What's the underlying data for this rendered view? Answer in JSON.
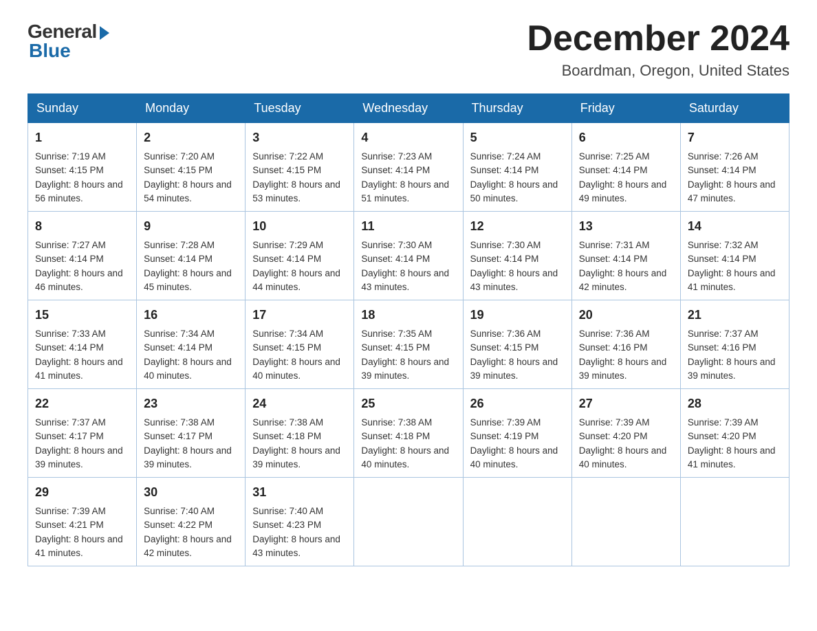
{
  "header": {
    "logo_general": "General",
    "logo_blue": "Blue",
    "month_year": "December 2024",
    "location": "Boardman, Oregon, United States"
  },
  "days_of_week": [
    "Sunday",
    "Monday",
    "Tuesday",
    "Wednesday",
    "Thursday",
    "Friday",
    "Saturday"
  ],
  "weeks": [
    [
      {
        "day": "1",
        "sunrise": "7:19 AM",
        "sunset": "4:15 PM",
        "daylight": "8 hours and 56 minutes."
      },
      {
        "day": "2",
        "sunrise": "7:20 AM",
        "sunset": "4:15 PM",
        "daylight": "8 hours and 54 minutes."
      },
      {
        "day": "3",
        "sunrise": "7:22 AM",
        "sunset": "4:15 PM",
        "daylight": "8 hours and 53 minutes."
      },
      {
        "day": "4",
        "sunrise": "7:23 AM",
        "sunset": "4:14 PM",
        "daylight": "8 hours and 51 minutes."
      },
      {
        "day": "5",
        "sunrise": "7:24 AM",
        "sunset": "4:14 PM",
        "daylight": "8 hours and 50 minutes."
      },
      {
        "day": "6",
        "sunrise": "7:25 AM",
        "sunset": "4:14 PM",
        "daylight": "8 hours and 49 minutes."
      },
      {
        "day": "7",
        "sunrise": "7:26 AM",
        "sunset": "4:14 PM",
        "daylight": "8 hours and 47 minutes."
      }
    ],
    [
      {
        "day": "8",
        "sunrise": "7:27 AM",
        "sunset": "4:14 PM",
        "daylight": "8 hours and 46 minutes."
      },
      {
        "day": "9",
        "sunrise": "7:28 AM",
        "sunset": "4:14 PM",
        "daylight": "8 hours and 45 minutes."
      },
      {
        "day": "10",
        "sunrise": "7:29 AM",
        "sunset": "4:14 PM",
        "daylight": "8 hours and 44 minutes."
      },
      {
        "day": "11",
        "sunrise": "7:30 AM",
        "sunset": "4:14 PM",
        "daylight": "8 hours and 43 minutes."
      },
      {
        "day": "12",
        "sunrise": "7:30 AM",
        "sunset": "4:14 PM",
        "daylight": "8 hours and 43 minutes."
      },
      {
        "day": "13",
        "sunrise": "7:31 AM",
        "sunset": "4:14 PM",
        "daylight": "8 hours and 42 minutes."
      },
      {
        "day": "14",
        "sunrise": "7:32 AM",
        "sunset": "4:14 PM",
        "daylight": "8 hours and 41 minutes."
      }
    ],
    [
      {
        "day": "15",
        "sunrise": "7:33 AM",
        "sunset": "4:14 PM",
        "daylight": "8 hours and 41 minutes."
      },
      {
        "day": "16",
        "sunrise": "7:34 AM",
        "sunset": "4:14 PM",
        "daylight": "8 hours and 40 minutes."
      },
      {
        "day": "17",
        "sunrise": "7:34 AM",
        "sunset": "4:15 PM",
        "daylight": "8 hours and 40 minutes."
      },
      {
        "day": "18",
        "sunrise": "7:35 AM",
        "sunset": "4:15 PM",
        "daylight": "8 hours and 39 minutes."
      },
      {
        "day": "19",
        "sunrise": "7:36 AM",
        "sunset": "4:15 PM",
        "daylight": "8 hours and 39 minutes."
      },
      {
        "day": "20",
        "sunrise": "7:36 AM",
        "sunset": "4:16 PM",
        "daylight": "8 hours and 39 minutes."
      },
      {
        "day": "21",
        "sunrise": "7:37 AM",
        "sunset": "4:16 PM",
        "daylight": "8 hours and 39 minutes."
      }
    ],
    [
      {
        "day": "22",
        "sunrise": "7:37 AM",
        "sunset": "4:17 PM",
        "daylight": "8 hours and 39 minutes."
      },
      {
        "day": "23",
        "sunrise": "7:38 AM",
        "sunset": "4:17 PM",
        "daylight": "8 hours and 39 minutes."
      },
      {
        "day": "24",
        "sunrise": "7:38 AM",
        "sunset": "4:18 PM",
        "daylight": "8 hours and 39 minutes."
      },
      {
        "day": "25",
        "sunrise": "7:38 AM",
        "sunset": "4:18 PM",
        "daylight": "8 hours and 40 minutes."
      },
      {
        "day": "26",
        "sunrise": "7:39 AM",
        "sunset": "4:19 PM",
        "daylight": "8 hours and 40 minutes."
      },
      {
        "day": "27",
        "sunrise": "7:39 AM",
        "sunset": "4:20 PM",
        "daylight": "8 hours and 40 minutes."
      },
      {
        "day": "28",
        "sunrise": "7:39 AM",
        "sunset": "4:20 PM",
        "daylight": "8 hours and 41 minutes."
      }
    ],
    [
      {
        "day": "29",
        "sunrise": "7:39 AM",
        "sunset": "4:21 PM",
        "daylight": "8 hours and 41 minutes."
      },
      {
        "day": "30",
        "sunrise": "7:40 AM",
        "sunset": "4:22 PM",
        "daylight": "8 hours and 42 minutes."
      },
      {
        "day": "31",
        "sunrise": "7:40 AM",
        "sunset": "4:23 PM",
        "daylight": "8 hours and 43 minutes."
      },
      null,
      null,
      null,
      null
    ]
  ],
  "labels": {
    "sunrise": "Sunrise:",
    "sunset": "Sunset:",
    "daylight": "Daylight:"
  }
}
